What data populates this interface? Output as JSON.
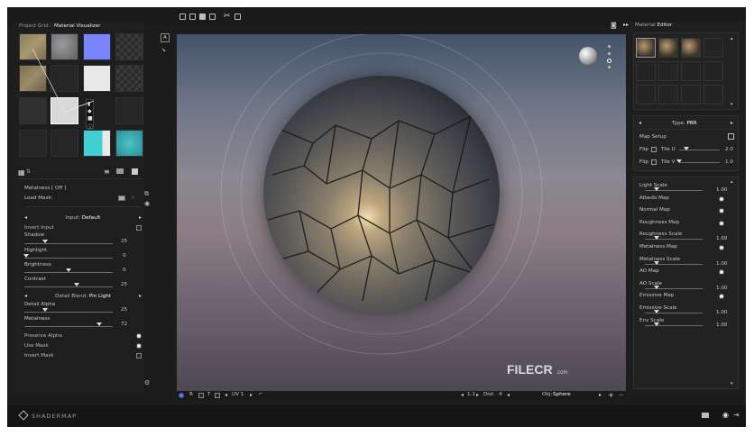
{
  "left": {
    "header": "Project Grid",
    "header_title": "Material Visualizer",
    "load_mask_label": "Load Mask:",
    "metalness_header": "Metalness [ Off ]",
    "input_label": "Input:",
    "input_value": "Default",
    "invert_input": "Invert Input",
    "shadow": {
      "label": "Shadow",
      "value": "25"
    },
    "highlight": {
      "label": "Highlight",
      "value": "0"
    },
    "brightness": {
      "label": "Brightness",
      "value": "0"
    },
    "contrast": {
      "label": "Contrast",
      "value": "25"
    },
    "detail_blend_label": "Detail Blend:",
    "detail_blend_value": "Pin Light",
    "detail_alpha": {
      "label": "Detail Alpha",
      "value": "25"
    },
    "metalness": {
      "label": "Metalness",
      "value": "72"
    },
    "preserve_alpha": "Preserve Alpha",
    "use_mask": "Use Mask",
    "invert_mask": "Invert Mask"
  },
  "viewport": {
    "uv_label": "UV 1",
    "dist_label": "Dist:",
    "dist_value": "4",
    "dist_prefix": "1.1",
    "obj_label": "Obj:",
    "obj_value": "Sphere",
    "watermark": "FILECR",
    "watermark_sub": ".com"
  },
  "right": {
    "title_prefix": "Material",
    "title": "Editor",
    "type_label": "Type:",
    "type_value": "PBR",
    "map_setup": "Map Setup",
    "flip_label": "Flip",
    "tile_u": "Tile U",
    "tile_u_value": "2.0",
    "tile_v": "Tile V",
    "tile_v_value": "1.0",
    "props": [
      {
        "label": "Light Scale",
        "kind": "slider",
        "value": "1.00"
      },
      {
        "label": "Albedo Map",
        "kind": "radio"
      },
      {
        "label": "Normal Map",
        "kind": "radio"
      },
      {
        "label": "Roughness Map",
        "kind": "radio"
      },
      {
        "label": "Roughness Scale",
        "kind": "slider",
        "value": "1.00"
      },
      {
        "label": "Metalness Map",
        "kind": "radio"
      },
      {
        "label": "Metalness Scale",
        "kind": "slider",
        "value": "1.00"
      },
      {
        "label": "AO Map",
        "kind": "radio"
      },
      {
        "label": "AO Scale",
        "kind": "slider",
        "value": "1.00"
      },
      {
        "label": "Emissive Map",
        "kind": "radio"
      },
      {
        "label": "Emissive Scale",
        "kind": "slider",
        "value": "1.00"
      },
      {
        "label": "Env Scale",
        "kind": "slider",
        "value": "1.00"
      }
    ]
  },
  "footer": {
    "brand": "SHADERMAP"
  },
  "colors": {
    "panel": "#1e1e1e",
    "accent_blue": "#7b84ff",
    "accent_teal": "#3fd0d4"
  }
}
